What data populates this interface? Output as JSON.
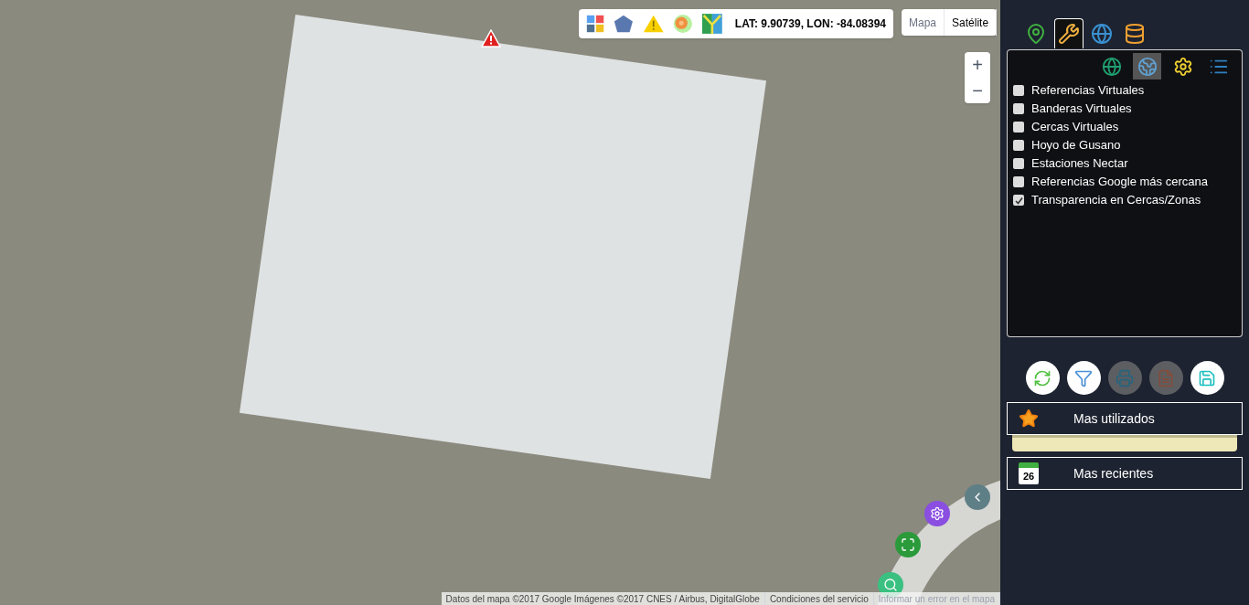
{
  "map": {
    "coordinates": "LAT: 9.90739, LON: -84.08394",
    "toolbar_tools": [
      {
        "kind": "grid"
      },
      {
        "kind": "pentagon"
      },
      {
        "kind": "warning"
      },
      {
        "kind": "snail"
      },
      {
        "kind": "route"
      }
    ],
    "map_types": [
      {
        "label": "Mapa",
        "selected": false
      },
      {
        "label": "Satélite",
        "selected": true
      }
    ],
    "zoom": {
      "in": "+",
      "out": "−"
    },
    "radial_menu": [
      {
        "kind": "back"
      },
      {
        "kind": "settings"
      },
      {
        "kind": "fullscreen"
      },
      {
        "kind": "search"
      }
    ],
    "attribution": [
      "Datos del mapa ©2017 Google Imágenes ©2017 CNES / Airbus, DigitalGlobe",
      "Condiciones del servicio",
      "Informar un error en el mapa"
    ]
  },
  "panel": {
    "tabs": [
      {
        "kind": "pin",
        "selected": false
      },
      {
        "kind": "tools",
        "selected": true
      },
      {
        "kind": "globe",
        "selected": false
      },
      {
        "kind": "database",
        "selected": false
      }
    ],
    "subtabs": [
      {
        "kind": "globe-pin",
        "selected": false
      },
      {
        "kind": "earth",
        "selected": true
      },
      {
        "kind": "gear",
        "selected": false
      },
      {
        "kind": "list",
        "selected": false
      }
    ],
    "options": [
      {
        "label": "Referencias Virtuales",
        "checked": false
      },
      {
        "label": "Banderas Virtuales",
        "checked": false
      },
      {
        "label": "Cercas Virtuales",
        "checked": false
      },
      {
        "label": "Hoyo de Gusano",
        "checked": false
      },
      {
        "label": "Estaciones Nectar",
        "checked": false
      },
      {
        "label": "Referencias Google más cercana",
        "checked": false
      },
      {
        "label": "Transparencia en Cercas/Zonas",
        "checked": true
      }
    ],
    "actions": [
      {
        "kind": "refresh",
        "disabled": false
      },
      {
        "kind": "filter",
        "disabled": false
      },
      {
        "kind": "print",
        "disabled": true
      },
      {
        "kind": "report",
        "disabled": true
      },
      {
        "kind": "save",
        "disabled": false
      }
    ],
    "sections": [
      {
        "kind": "star",
        "label": "Mas utilizados",
        "expanded": true
      },
      {
        "kind": "calendar",
        "label": "Mas recientes",
        "day": "26",
        "expanded": false
      }
    ]
  }
}
